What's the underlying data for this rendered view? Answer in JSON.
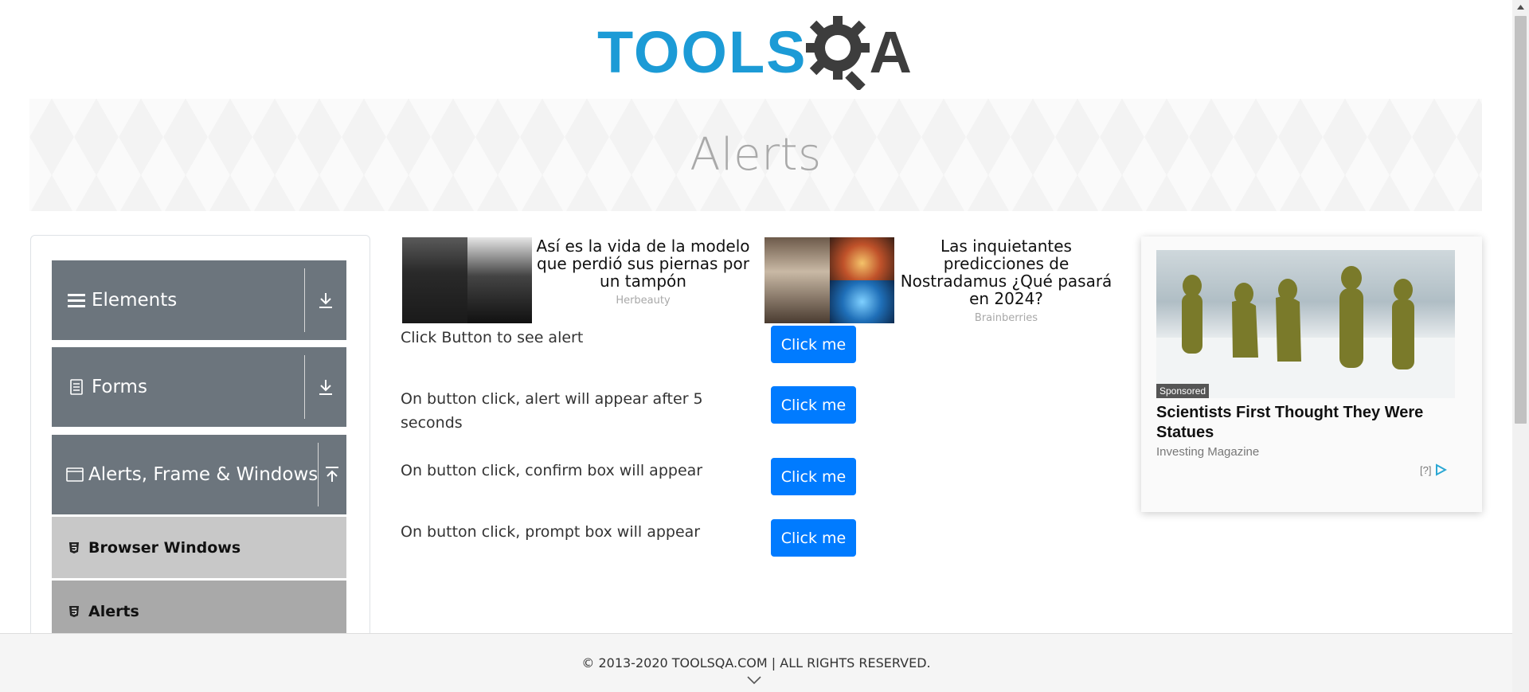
{
  "logo": {
    "text": "TOOLS",
    "text_end": "A",
    "alt": "TOOLSQA"
  },
  "banner": {
    "title": "Alerts"
  },
  "sidebar": {
    "groups": [
      {
        "label": "Elements",
        "icon": "hamburger-icon",
        "state": "collapsed"
      },
      {
        "label": "Forms",
        "icon": "document-icon",
        "state": "collapsed"
      },
      {
        "label": "Alerts, Frame & Windows",
        "icon": "window-icon",
        "state": "expanded"
      }
    ],
    "items": [
      {
        "label": "Browser Windows",
        "icon": "html5-icon"
      },
      {
        "label": "Alerts",
        "icon": "html5-icon",
        "active": true
      }
    ]
  },
  "ads": [
    {
      "title": "Así es la vida de la modelo que perdió sus piernas por un tampón",
      "source": "Herbeauty"
    },
    {
      "title": "Las inquietantes predicciones de Nostradamus ¿Qué pasará en 2024?",
      "source": "Brainberries"
    }
  ],
  "rows": [
    {
      "label": "Click Button to see alert",
      "button": "Click me"
    },
    {
      "label": "On button click, alert will appear after 5 seconds",
      "button": "Click me"
    },
    {
      "label": "On button click, confirm box will appear",
      "button": "Click me"
    },
    {
      "label": "On button click, prompt box will appear",
      "button": "Click me"
    }
  ],
  "side_ad": {
    "badge": "Sponsored",
    "title": "Scientists First Thought They Were Statues",
    "source": "Investing Magazine",
    "adchoice": "[?]"
  },
  "footer": {
    "text": "© 2013-2020 TOOLSQA.COM | ALL RIGHTS RESERVED."
  },
  "colors": {
    "primary": "#007bff",
    "sidebar_group": "#6c757d",
    "logo_blue": "#1c9bd6",
    "logo_dark": "#3d3d3d"
  }
}
